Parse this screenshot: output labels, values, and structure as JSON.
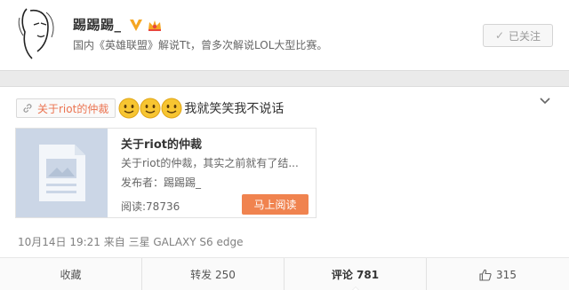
{
  "profile": {
    "name": "踢踢踢_",
    "bio": "国内《英雄联盟》解说Tt，曾多次解说LOL大型比赛。",
    "follow_label": "已关注",
    "icons": [
      "avatar-sketch",
      "verified-v-icon",
      "crown-icon",
      "check-icon"
    ]
  },
  "post": {
    "topic_tag": "关于riot的仲裁",
    "emoji_count": 3,
    "text": "我就笑笑我不说话",
    "share_card": {
      "title": "关于riot的仲裁",
      "description": "关于riot的仲裁，其实之前就有了结...",
      "publisher": "发布者：踢踢踢_",
      "reads": "阅读:78736",
      "read_button": "马上阅读"
    },
    "meta": "10月14日 19:21 来自 三星 GALAXY S6 edge"
  },
  "actions": {
    "favorite": "收藏",
    "repost": "转发 250",
    "comment": "评论 781",
    "like": "315"
  },
  "colors": {
    "accent": "#eb7350",
    "read_button": "#f0834f",
    "verified": "#f5a623",
    "thumb": "#cbd6e6"
  }
}
